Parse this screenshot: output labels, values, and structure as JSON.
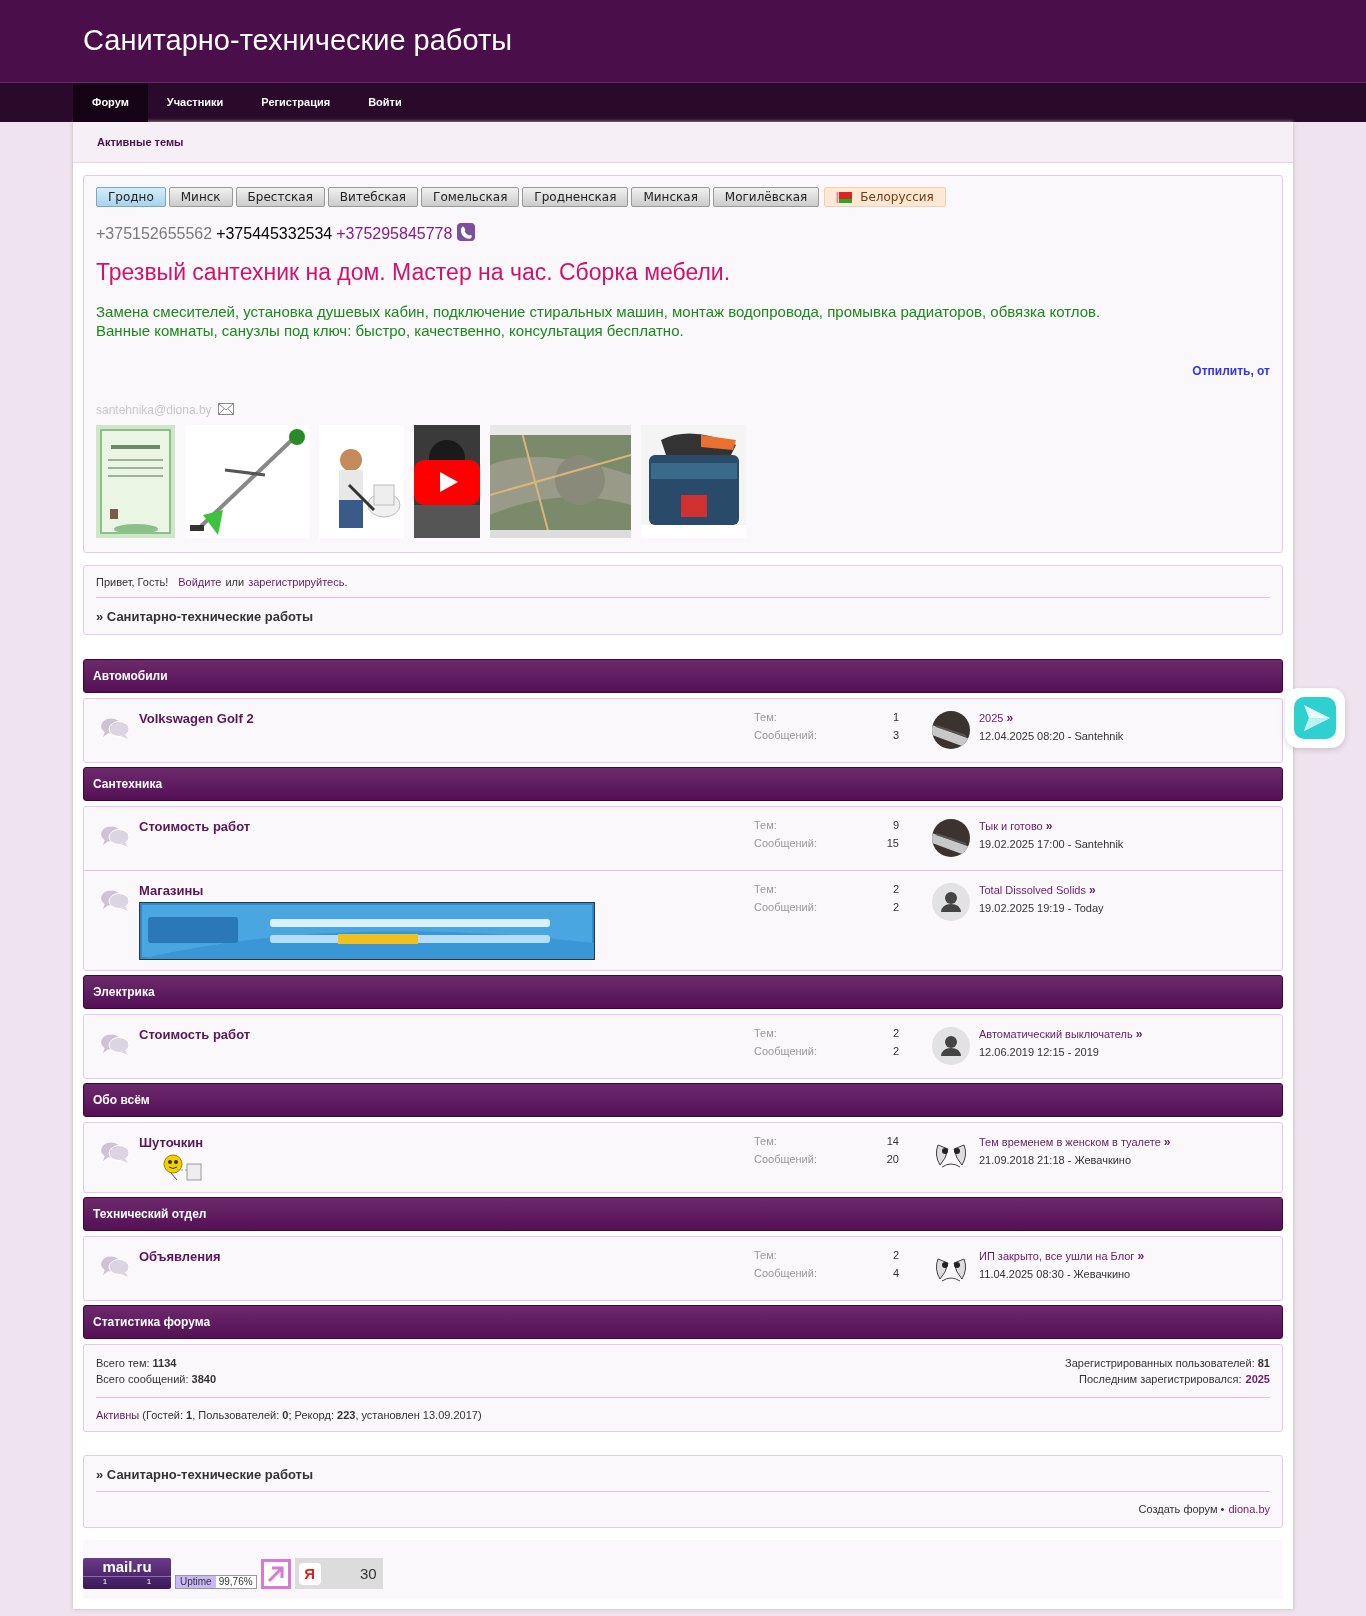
{
  "site_title": "Санитарно-технические работы",
  "nav": [
    {
      "label": "Форум",
      "selected": true
    },
    {
      "label": "Участники",
      "selected": false
    },
    {
      "label": "Регистрация",
      "selected": false
    },
    {
      "label": "Войти",
      "selected": false
    }
  ],
  "subnav": [
    "Активные темы"
  ],
  "ad": {
    "regions": [
      {
        "label": "Гродно",
        "selected": true,
        "kind": "city"
      },
      {
        "label": "Минск",
        "selected": false,
        "kind": "city"
      },
      {
        "label": "Брестская",
        "selected": false,
        "kind": "city"
      },
      {
        "label": "Витебская",
        "selected": false,
        "kind": "city"
      },
      {
        "label": "Гомельская",
        "selected": false,
        "kind": "city"
      },
      {
        "label": "Гродненская",
        "selected": false,
        "kind": "city"
      },
      {
        "label": "Минская",
        "selected": false,
        "kind": "city"
      },
      {
        "label": "Могилёвская",
        "selected": false,
        "kind": "city"
      },
      {
        "label": "Белоруссия",
        "selected": false,
        "kind": "country"
      }
    ],
    "phones": [
      {
        "text": "+375152655562",
        "color": "#7a7a7a"
      },
      {
        "text": "+375445332534",
        "color": "#000000"
      },
      {
        "text": "+375295845778",
        "color": "#8a1a8a"
      }
    ],
    "headline": "Трезвый сантехник на дом. Мастер на час. Сборка мебели.",
    "description": [
      "Замена смесителей, установка душевых кабин, подключение стиральных машин, монтаж водопровода, промывка радиаторов, обвязка котлов.",
      "Ванные комнаты, санузлы под ключ: быстро, качественно, консультация бесплатно."
    ],
    "ticker": "Отпилить, от",
    "email": "santehnika@diona.by"
  },
  "greeting": {
    "text": "Привет, Гость!",
    "login": "Войдите",
    "or": "или",
    "register": "зарегистрируйтесь",
    "end": "."
  },
  "breadcrumb": "» Санитарно-технические работы",
  "categories": [
    {
      "title": "Автомобили",
      "forums": [
        {
          "title": "Volkswagen Golf 2",
          "topics_label": "Тем:",
          "topics": "1",
          "posts_label": "Сообщений:",
          "posts": "3",
          "last_title": "2025",
          "go": "»",
          "last_meta": "12.04.2025 08:20 - Santehnik"
        }
      ]
    },
    {
      "title": "Сантехника",
      "forums": [
        {
          "title": "Стоимость работ",
          "topics_label": "Тем:",
          "topics": "9",
          "posts_label": "Сообщений:",
          "posts": "15",
          "last_title": "Тык и готово",
          "go": "»",
          "last_meta": "19.02.2025 17:00 - Santehnik"
        },
        {
          "title": "Магазины",
          "attachment": {
            "kind": "banner"
          },
          "topics_label": "Тем:",
          "topics": "2",
          "posts_label": "Сообщений:",
          "posts": "2",
          "avatar": {
            "kind": "silhouette"
          },
          "last_title": "Total Dissolved Solids",
          "go": "»",
          "last_meta": "19.02.2025 19:19 - Today"
        }
      ]
    },
    {
      "title": "Электрика",
      "forums": [
        {
          "title": "Стоимость работ",
          "topics_label": "Тем:",
          "topics": "2",
          "posts_label": "Сообщений:",
          "posts": "2",
          "avatar": {
            "kind": "silhouette"
          },
          "last_title": "Автоматический выключатель",
          "go": "»",
          "last_meta": "12.06.2019 12:15 - 2019"
        }
      ]
    },
    {
      "title": "Обо всём",
      "forums": [
        {
          "title": "Шуточкин",
          "attachment": {
            "kind": "smiley"
          },
          "topics_label": "Тем:",
          "topics": "14",
          "posts_label": "Сообщений:",
          "posts": "20",
          "avatar": {
            "kind": "sketch"
          },
          "last_title": "Тем временем в женском в туалете",
          "go": "»",
          "last_meta": "21.09.2018 21:18 - Жевачкино"
        }
      ]
    },
    {
      "title": "Технический отдел",
      "forums": [
        {
          "title": "Объявления",
          "topics_label": "Тем:",
          "topics": "2",
          "posts_label": "Сообщений:",
          "posts": "4",
          "avatar": {
            "kind": "sketch"
          },
          "last_title": "ИП закрыто, все ушли на Блог",
          "go": "»",
          "last_meta": "11.04.2025 08:30 - Жевачкино"
        }
      ]
    }
  ],
  "stats": {
    "title": "Статистика форума",
    "left": [
      "Всего тем: **1134**",
      "Всего сообщений: **3840**"
    ],
    "right": [
      {
        "text": "Зарегистрированных пользователей: **81**"
      },
      {
        "text": "Последним зарегистрировался:",
        "link": "2025"
      }
    ],
    "active_link": "Активны",
    "active_text": "(Гостей: **1**, Пользователей: **0**; Рекорд: **223**, установлен 13.09.2017)"
  },
  "footer": {
    "breadcrumb": "» Санитарно-технические работы",
    "create": "Создать форум •",
    "link": "diona.by"
  },
  "counters": {
    "mailru": {
      "logo": "mail.ru",
      "values": [
        "1",
        "1"
      ]
    },
    "uptime": {
      "label": "Uptime",
      "value": "99,76%"
    },
    "yandex": {
      "logo": "Я",
      "value": "30"
    }
  }
}
